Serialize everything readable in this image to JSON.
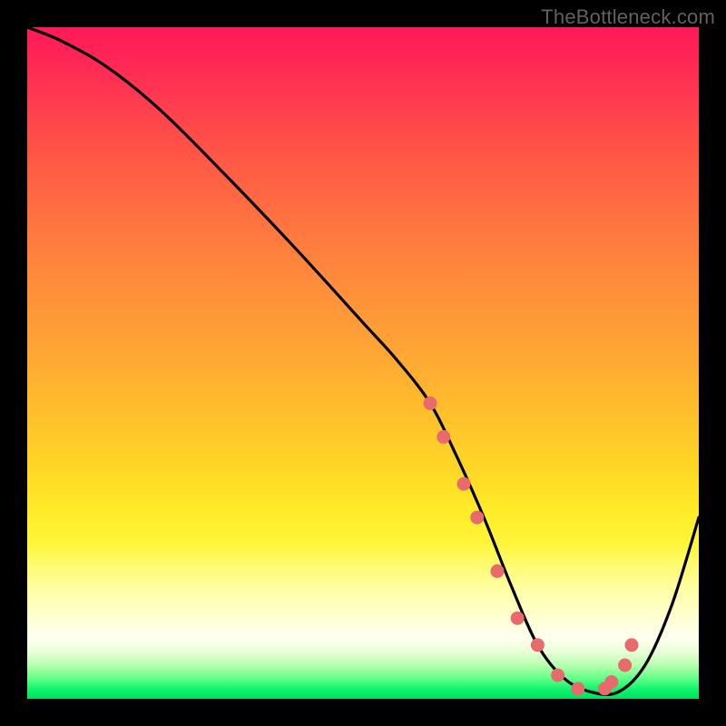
{
  "attribution": "TheBottleneck.com",
  "chart_data": {
    "type": "line",
    "title": "",
    "xlabel": "",
    "ylabel": "",
    "x_range": [
      0,
      100
    ],
    "y_range": [
      0,
      100
    ],
    "series": [
      {
        "name": "bottleneck-curve",
        "x": [
          0,
          5,
          12,
          20,
          30,
          40,
          50,
          55,
          60,
          64,
          68,
          72,
          76,
          80,
          84,
          88,
          92,
          96,
          100
        ],
        "y": [
          100,
          98,
          94,
          87.5,
          77.5,
          67,
          56,
          50.5,
          44,
          36,
          27,
          17,
          8,
          3,
          1,
          1,
          5,
          14,
          27
        ]
      }
    ],
    "markers": {
      "name": "highlight-points",
      "x": [
        60,
        62,
        65,
        67,
        70,
        73,
        76,
        79,
        82,
        86,
        87,
        89,
        90
      ],
      "y": [
        44,
        39,
        32,
        27,
        19,
        12,
        8,
        3.5,
        1.5,
        1.5,
        2.5,
        5,
        8
      ]
    },
    "gradient_stops": [
      {
        "pct": 0,
        "color": "#ff1959"
      },
      {
        "pct": 50,
        "color": "#ffaa33"
      },
      {
        "pct": 80,
        "color": "#fffb70"
      },
      {
        "pct": 95,
        "color": "#b7ffaf"
      },
      {
        "pct": 100,
        "color": "#00e060"
      }
    ]
  }
}
